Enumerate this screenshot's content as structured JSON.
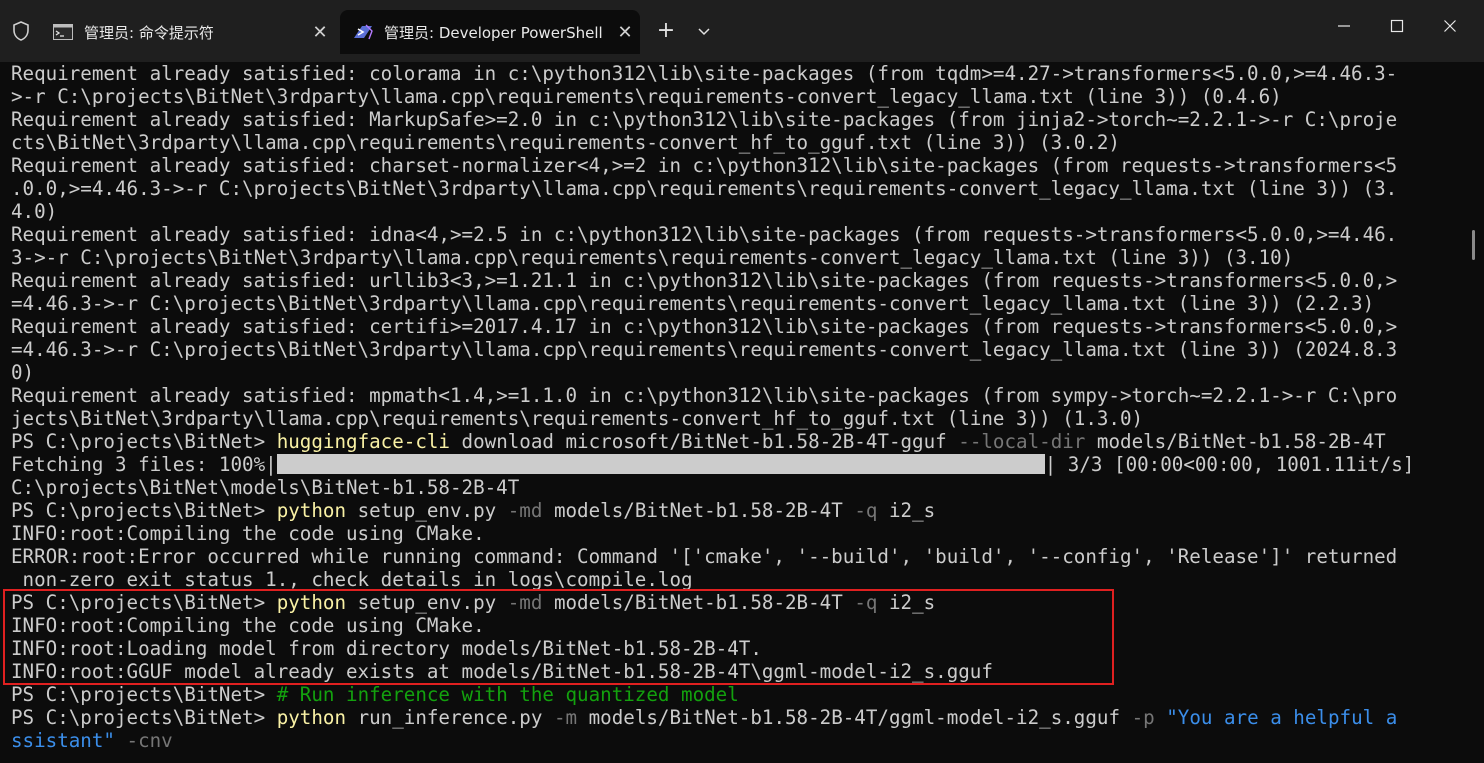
{
  "tabs": [
    {
      "label": "管理员: 命令提示符",
      "icon": "cmd-icon",
      "active": false
    },
    {
      "label": "管理员: Developer PowerShell",
      "icon": "powershell-icon",
      "active": true
    }
  ],
  "new_tab_label": "+",
  "terminal": {
    "lines": [
      {
        "segs": [
          {
            "t": "Requirement already satisfied: colorama in c:\\python312\\lib\\site-packages (from tqdm>=4.27->transformers<5.0.0,>=4.46.3-"
          }
        ]
      },
      {
        "segs": [
          {
            "t": ">-r C:\\projects\\BitNet\\3rdparty\\llama.cpp\\requirements\\requirements-convert_legacy_llama.txt (line 3)) (0.4.6)"
          }
        ]
      },
      {
        "segs": [
          {
            "t": "Requirement already satisfied: MarkupSafe>=2.0 in c:\\python312\\lib\\site-packages (from jinja2->torch~=2.2.1->-r C:\\proje"
          }
        ]
      },
      {
        "segs": [
          {
            "t": "cts\\BitNet\\3rdparty\\llama.cpp\\requirements\\requirements-convert_hf_to_gguf.txt (line 3)) (3.0.2)"
          }
        ]
      },
      {
        "segs": [
          {
            "t": "Requirement already satisfied: charset-normalizer<4,>=2 in c:\\python312\\lib\\site-packages (from requests->transformers<5"
          }
        ]
      },
      {
        "segs": [
          {
            "t": ".0.0,>=4.46.3->-r C:\\projects\\BitNet\\3rdparty\\llama.cpp\\requirements\\requirements-convert_legacy_llama.txt (line 3)) (3."
          }
        ]
      },
      {
        "segs": [
          {
            "t": "4.0)"
          }
        ]
      },
      {
        "segs": [
          {
            "t": "Requirement already satisfied: idna<4,>=2.5 in c:\\python312\\lib\\site-packages (from requests->transformers<5.0.0,>=4.46."
          }
        ]
      },
      {
        "segs": [
          {
            "t": "3->-r C:\\projects\\BitNet\\3rdparty\\llama.cpp\\requirements\\requirements-convert_legacy_llama.txt (line 3)) (3.10)"
          }
        ]
      },
      {
        "segs": [
          {
            "t": "Requirement already satisfied: urllib3<3,>=1.21.1 in c:\\python312\\lib\\site-packages (from requests->transformers<5.0.0,>"
          }
        ]
      },
      {
        "segs": [
          {
            "t": "=4.46.3->-r C:\\projects\\BitNet\\3rdparty\\llama.cpp\\requirements\\requirements-convert_legacy_llama.txt (line 3)) (2.2.3)"
          }
        ]
      },
      {
        "segs": [
          {
            "t": "Requirement already satisfied: certifi>=2017.4.17 in c:\\python312\\lib\\site-packages (from requests->transformers<5.0.0,>"
          }
        ]
      },
      {
        "segs": [
          {
            "t": "=4.46.3->-r C:\\projects\\BitNet\\3rdparty\\llama.cpp\\requirements\\requirements-convert_legacy_llama.txt (line 3)) (2024.8.3"
          }
        ]
      },
      {
        "segs": [
          {
            "t": "0)"
          }
        ]
      },
      {
        "segs": [
          {
            "t": "Requirement already satisfied: mpmath<1.4,>=1.1.0 in c:\\python312\\lib\\site-packages (from sympy->torch~=2.2.1->-r C:\\pro"
          }
        ]
      },
      {
        "segs": [
          {
            "t": "jects\\BitNet\\3rdparty\\llama.cpp\\requirements\\requirements-convert_hf_to_gguf.txt (line 3)) (1.3.0)"
          }
        ]
      },
      {
        "segs": [
          {
            "t": "PS C:\\projects\\BitNet> "
          },
          {
            "t": "huggingface-cli",
            "c": "cmd"
          },
          {
            "t": " download microsoft/BitNet-b1.58-2B-4T-gguf "
          },
          {
            "t": "--local-dir",
            "c": "flag"
          },
          {
            "t": " models/BitNet-b1.58-2B-4T"
          }
        ]
      },
      {
        "segs": [
          {
            "t": "Fetching 3 files: 100%|"
          },
          {
            "bar": 1.0
          },
          {
            "t": "| 3/3 [00:00<00:00, 1001.11it/s]"
          }
        ]
      },
      {
        "segs": [
          {
            "t": "C:\\projects\\BitNet\\models\\BitNet-b1.58-2B-4T"
          }
        ]
      },
      {
        "segs": [
          {
            "t": "PS C:\\projects\\BitNet> "
          },
          {
            "t": "python",
            "c": "cmd"
          },
          {
            "t": " setup_env.py "
          },
          {
            "t": "-md",
            "c": "flag"
          },
          {
            "t": " models/BitNet-b1.58-2B-4T "
          },
          {
            "t": "-q",
            "c": "flag"
          },
          {
            "t": " i2_s"
          }
        ]
      },
      {
        "segs": [
          {
            "t": "INFO:root:Compiling the code using CMake."
          }
        ]
      },
      {
        "segs": [
          {
            "t": "ERROR:root:Error occurred while running command: Command '['cmake', '--build', 'build', '--config', 'Release']' returned"
          }
        ]
      },
      {
        "segs": [
          {
            "t": " non-zero exit status 1., check details in logs\\compile.log"
          }
        ]
      },
      {
        "segs": [
          {
            "t": "PS C:\\projects\\BitNet> "
          },
          {
            "t": "python",
            "c": "cmd"
          },
          {
            "t": " setup_env.py "
          },
          {
            "t": "-md",
            "c": "flag"
          },
          {
            "t": " models/BitNet-b1.58-2B-4T "
          },
          {
            "t": "-q",
            "c": "flag"
          },
          {
            "t": " i2_s"
          }
        ]
      },
      {
        "segs": [
          {
            "t": "INFO:root:Compiling the code using CMake."
          }
        ]
      },
      {
        "segs": [
          {
            "t": "INFO:root:Loading model from directory models/BitNet-b1.58-2B-4T."
          }
        ]
      },
      {
        "segs": [
          {
            "t": "INFO:root:GGUF model already exists at models/BitNet-b1.58-2B-4T\\ggml-model-i2_s.gguf"
          }
        ]
      },
      {
        "segs": [
          {
            "t": "PS C:\\projects\\BitNet> "
          },
          {
            "t": "# Run inference with the quantized model",
            "c": "comment"
          }
        ]
      },
      {
        "segs": [
          {
            "t": "PS C:\\projects\\BitNet> "
          },
          {
            "t": "python",
            "c": "cmd"
          },
          {
            "t": " run_inference.py "
          },
          {
            "t": "-m",
            "c": "flag"
          },
          {
            "t": " models/BitNet-b1.58-2B-4T/ggml-model-i2_s.gguf "
          },
          {
            "t": "-p",
            "c": "flag"
          },
          {
            "t": " "
          },
          {
            "t": "\"You are a helpful a",
            "c": "str"
          }
        ]
      },
      {
        "segs": [
          {
            "t": "ssistant\"",
            "c": "str"
          },
          {
            "t": " "
          },
          {
            "t": "-cnv",
            "c": "flag"
          }
        ]
      }
    ]
  }
}
